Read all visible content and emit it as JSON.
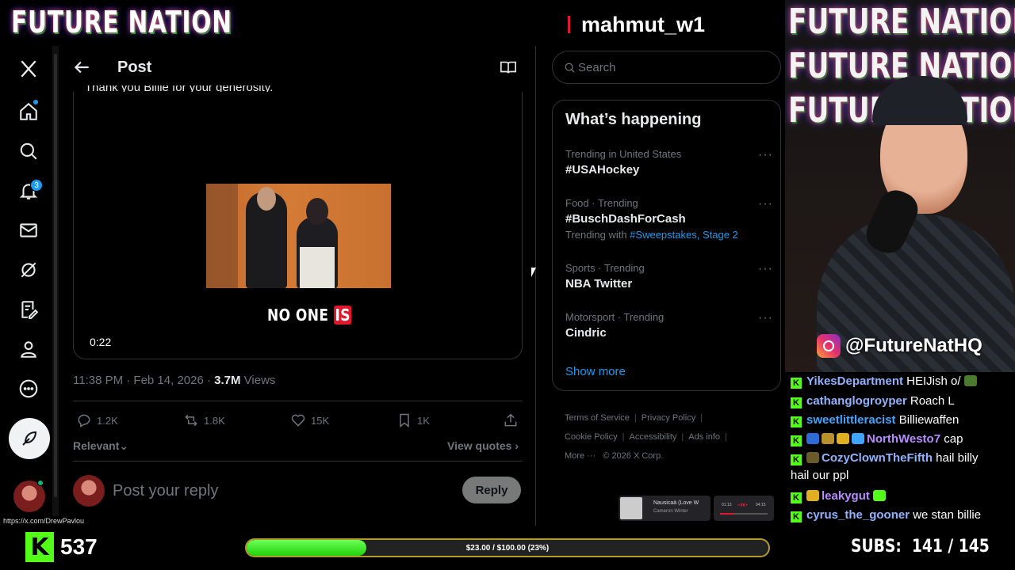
{
  "overlay": {
    "brand": "FUTURE NATION",
    "stream_user": "mahmut_w1",
    "social_handle": "@FutureNatHQ",
    "kick_count": "537",
    "goal_label": "$23.00 / $100.00 (23%)",
    "goal_progress": 0.23,
    "subs_label": "SUBS:",
    "subs_value": "141 / 145",
    "status_url": "https://x.com/DrewPavlou",
    "now_playing": {
      "title": "Nausicaä (Love W",
      "artist": "Cameron Winter",
      "elapsed": "01:13",
      "total": "04:15"
    }
  },
  "x": {
    "post": {
      "header_title": "Post",
      "text": "Thank you Billie for your generosity.",
      "caption_part1": "NO ONE ",
      "caption_part2": "IS",
      "video_time": "0:22",
      "meta_time": "11:38 PM · Feb 14, 2026 · ",
      "views_count": "3.7M",
      "views_label": " Views",
      "replies": "1.2K",
      "reposts": "1.8K",
      "likes": "15K",
      "bookmarks": "1K",
      "sort_label": "Relevant",
      "view_quotes": "View quotes",
      "reply_placeholder": "Post your reply",
      "reply_button": "Reply"
    },
    "nav": {
      "notification_badge": "3"
    },
    "search_placeholder": "Search",
    "trends": {
      "title": "What’s happening",
      "items": [
        {
          "context": "Trending in United States",
          "name": "#USAHockey"
        },
        {
          "context": "Food · Trending",
          "name": "#BuschDashForCash",
          "with_prefix": "Trending with ",
          "with_tags": "#Sweepstakes, Stage 2"
        },
        {
          "context": "Sports · Trending",
          "name": "NBA Twitter"
        },
        {
          "context": "Motorsport · Trending",
          "name": "Cindric"
        }
      ],
      "show_more": "Show more"
    },
    "footer": {
      "terms": "Terms of Service",
      "privacy": "Privacy Policy",
      "cookie": "Cookie Policy",
      "accessibility": "Accessibility",
      "ads": "Ads info",
      "more": "More ···",
      "copyright": "© 2026 X Corp."
    }
  },
  "chat": [
    {
      "user": "YikesDepartment",
      "color": "#8fb3ff",
      "msg": " HEIJish o/"
    },
    {
      "user": "cathanglogroyper",
      "color": "#8fb3ff",
      "msg": " Roach L"
    },
    {
      "user": "sweetlittleracist",
      "color": "#3ea6ff",
      "msg": " Billiewaffen"
    },
    {
      "user": "NorthWesto7",
      "color": "#b98cff",
      "msg": " cap"
    },
    {
      "user": "CozyClownTheFifth",
      "color": "#8fb3ff",
      "msg": " hail billy"
    },
    {
      "user": "",
      "color": "#fff",
      "msg": "hail our ppl"
    },
    {
      "user": "leakygut",
      "color": "#b98cff",
      "msg": ""
    },
    {
      "user": "cyrus_the_gooner",
      "color": "#8fb3ff",
      "msg": " we stan billie"
    }
  ],
  "colors": {
    "accent": "#1d9bf0",
    "kick_green": "#53fc18",
    "live_red": "#e0182d"
  }
}
